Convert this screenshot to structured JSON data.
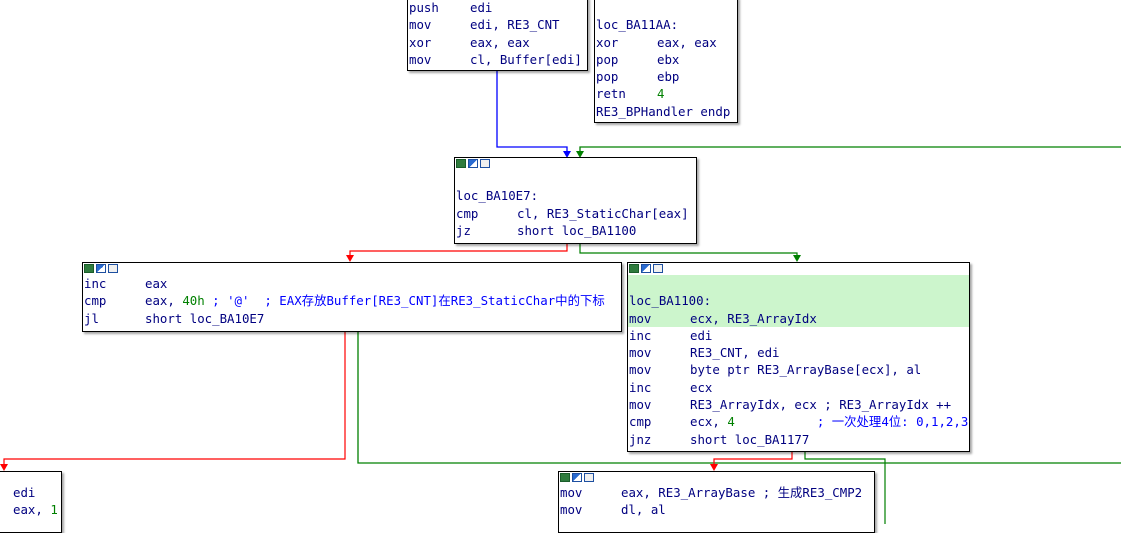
{
  "blocks": {
    "b1": {
      "lines": [
        {
          "mn": "push",
          "op": "edi"
        },
        {
          "mn": "mov",
          "op": "edi, RE3_CNT"
        },
        {
          "mn": "xor",
          "op": "eax, eax"
        },
        {
          "mn": "mov",
          "op": "cl, Buffer[edi]"
        }
      ]
    },
    "b2": {
      "label": "loc_BA11AA:",
      "lines": [
        {
          "mn": "xor",
          "op": "eax, eax"
        },
        {
          "mn": "pop",
          "op": "ebx"
        },
        {
          "mn": "pop",
          "op": "ebp"
        },
        {
          "mn": "retn",
          "op": "4"
        }
      ],
      "end": "RE3_BPHandler endp"
    },
    "b3": {
      "label": "loc_BA10E7:",
      "lines": [
        {
          "mn": "cmp",
          "op": "cl, RE3_StaticChar[eax]"
        },
        {
          "mn": "jz",
          "op": "short loc_BA1100"
        }
      ]
    },
    "b4": {
      "lines": [
        {
          "mn": "inc",
          "op": "eax"
        },
        {
          "mn": "cmp",
          "op_a": "eax, ",
          "op_num": "40h",
          "op_c": " ; '@'  ; EAX存放Buffer[RE3_CNT]在RE3_StaticChar中的下标"
        },
        {
          "mn": "jl",
          "op": "short loc_BA10E7"
        }
      ]
    },
    "b5": {
      "label": "loc_BA1100:",
      "lines": [
        {
          "mn": "mov",
          "op": "ecx, RE3_ArrayIdx"
        },
        {
          "mn": "inc",
          "op": "edi"
        },
        {
          "mn": "mov",
          "op": "RE3_CNT, edi"
        },
        {
          "mn": "mov",
          "op": "byte ptr RE3_ArrayBase[ecx], al"
        },
        {
          "mn": "inc",
          "op": "ecx"
        },
        {
          "mn": "mov",
          "op": "RE3_ArrayIdx, ecx ; RE3_ArrayIdx ++"
        },
        {
          "mn": "cmp",
          "op_a": "ecx, ",
          "op_num": "4",
          "op_c": "           ; 一次处理4位: 0,1,2,3"
        },
        {
          "mn": "jnz",
          "op": "short loc_BA1177"
        }
      ]
    },
    "b6": {
      "lines": [
        {
          "mn": "mov",
          "op": "eax, RE3_ArrayBase ; 生成RE3_CMP2"
        },
        {
          "mn": "mov",
          "op": "dl, al"
        }
      ]
    },
    "b7": {
      "lines": [
        {
          "op": "edi"
        },
        {
          "op_a": "eax, ",
          "op_num": "1"
        }
      ]
    }
  },
  "colors": {
    "true_edge": "#008000",
    "false_edge": "#ff0000",
    "jump_edge": "#0000ff",
    "highlight": "#ccf5cc"
  }
}
